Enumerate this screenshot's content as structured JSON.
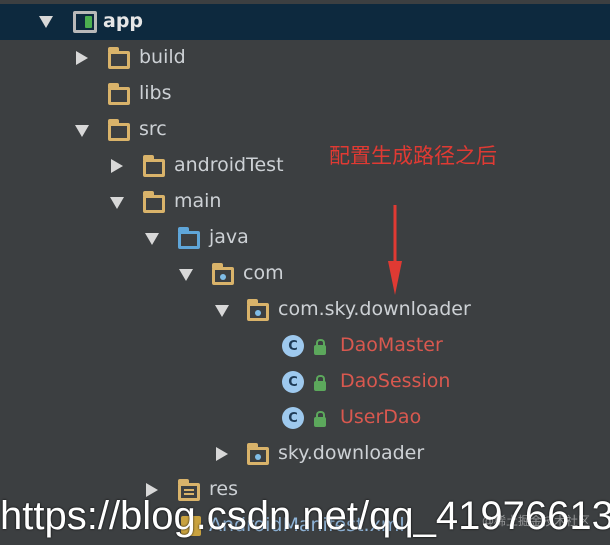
{
  "tree": {
    "root": {
      "label": "app",
      "expanded": true,
      "icon": "module-icon"
    },
    "items": [
      {
        "label": "build",
        "expanded": false,
        "icon": "folder-icon"
      },
      {
        "label": "libs",
        "icon": "folder-icon"
      },
      {
        "label": "src",
        "expanded": true,
        "icon": "folder-icon"
      },
      {
        "label": "androidTest",
        "expanded": false,
        "icon": "folder-icon"
      },
      {
        "label": "main",
        "expanded": true,
        "icon": "folder-icon"
      },
      {
        "label": "java",
        "expanded": true,
        "icon": "source-folder-icon"
      },
      {
        "label": "com",
        "expanded": true,
        "icon": "package-icon"
      },
      {
        "label": "com.sky.downloader",
        "expanded": true,
        "icon": "package-icon"
      },
      {
        "label": "DaoMaster",
        "icon": "class-icon"
      },
      {
        "label": "DaoSession",
        "icon": "class-icon"
      },
      {
        "label": "UserDao",
        "icon": "class-icon"
      },
      {
        "label": "sky.downloader",
        "expanded": false,
        "icon": "package-icon"
      },
      {
        "label": "res",
        "expanded": false,
        "icon": "resource-folder-icon"
      },
      {
        "label": "AndroidManifest.xml",
        "icon": "manifest-icon"
      }
    ],
    "class_icon_letter": "C"
  },
  "annotation": {
    "text": "配置生成路径之后",
    "color": "#e03a33"
  },
  "watermark": {
    "text": "https://blog.csdn.net/qq_41976613",
    "faint_text": "@稀土掘金技术社区"
  },
  "colors": {
    "background": "#3c3f41",
    "selection": "#0d293e",
    "folder": "#d9b36a",
    "source_folder": "#5fa6d9",
    "generated_class_text": "#d9584f"
  }
}
